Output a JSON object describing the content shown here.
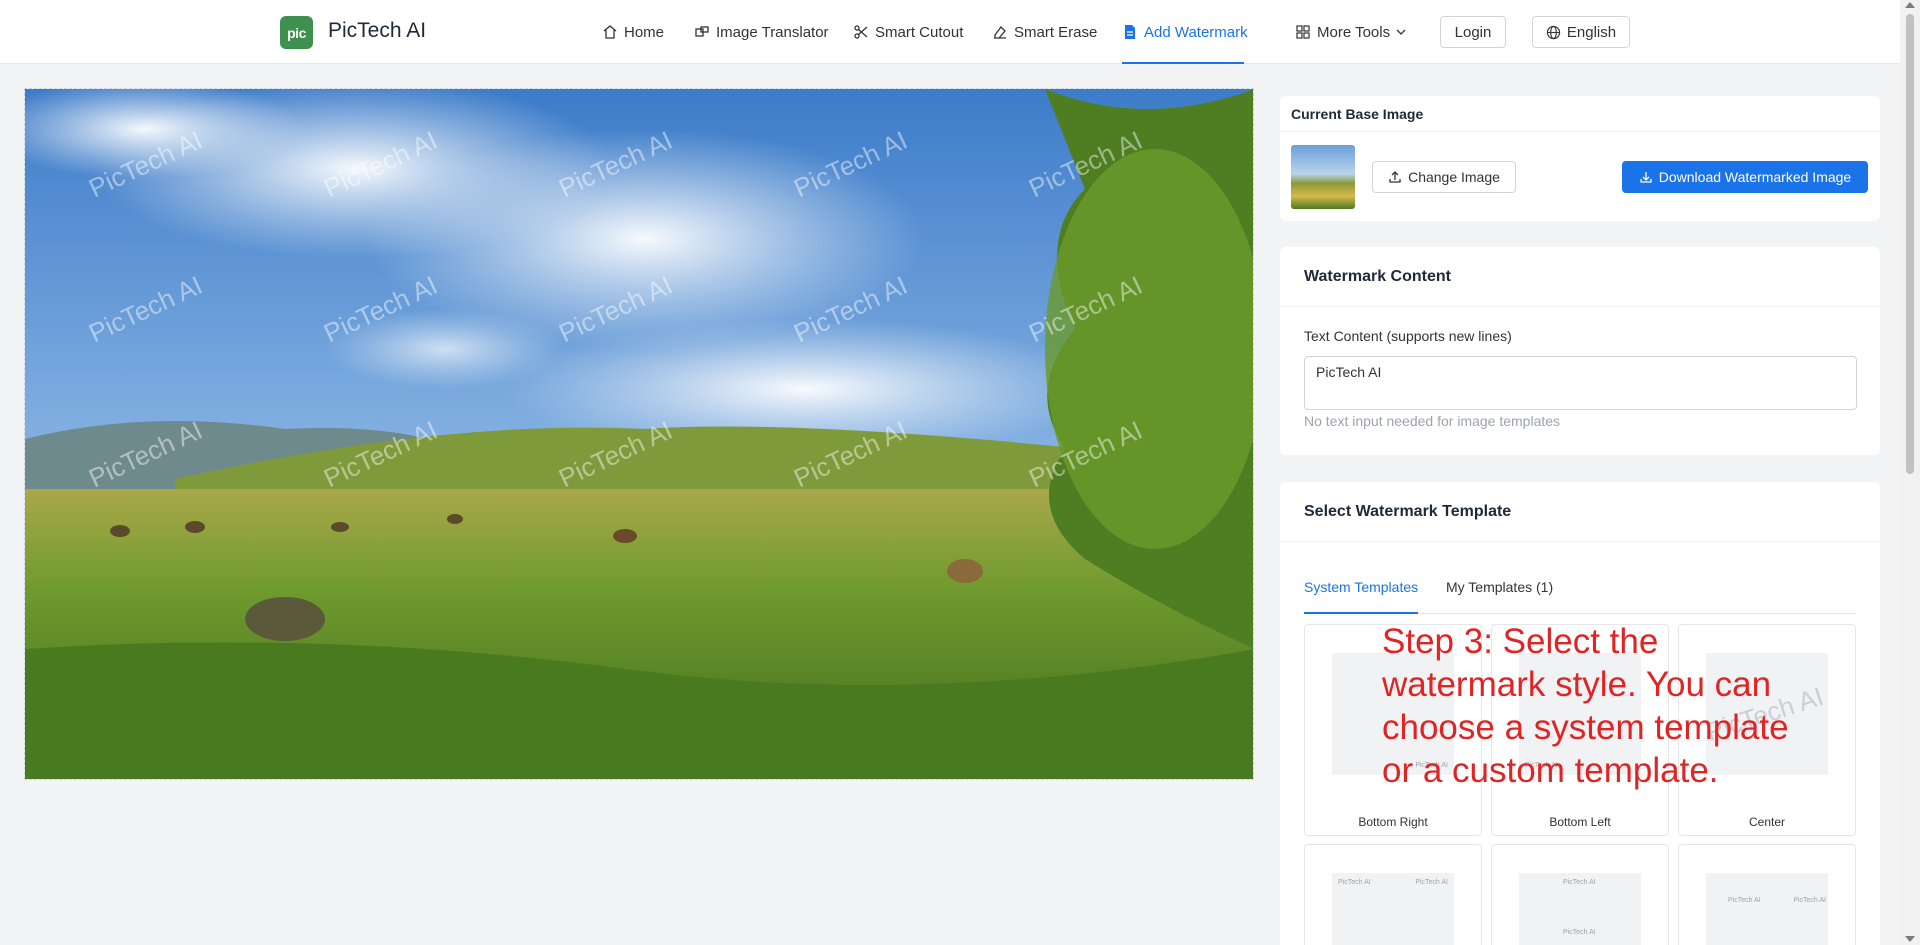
{
  "brand": {
    "logo_text": "pic",
    "name": "PicTech AI"
  },
  "nav": {
    "home": "Home",
    "translator": "Image Translator",
    "cutout": "Smart Cutout",
    "erase": "Smart Erase",
    "watermark": "Add Watermark",
    "more": "More Tools",
    "login": "Login",
    "language": "English"
  },
  "preview": {
    "watermark_text": "PicTech AI"
  },
  "base_image": {
    "title": "Current Base Image",
    "change": "Change Image",
    "download": "Download Watermarked Image"
  },
  "content": {
    "title": "Watermark Content",
    "label": "Text Content (supports new lines)",
    "value": "PicTech AI",
    "hint": "No text input needed for image templates"
  },
  "template": {
    "title": "Select Watermark Template",
    "tab_system": "System Templates",
    "tab_mine": "My Templates (1)",
    "items": [
      "Bottom Right",
      "Bottom Left",
      "Center"
    ],
    "thumb_text": "PicTech AI"
  },
  "annotation": "Step 3: Select the watermark style. You can choose a system template or a custom template.",
  "colors": {
    "accent": "#1a73e8",
    "annotation": "#e02424",
    "logo": "#3f8f4f"
  }
}
